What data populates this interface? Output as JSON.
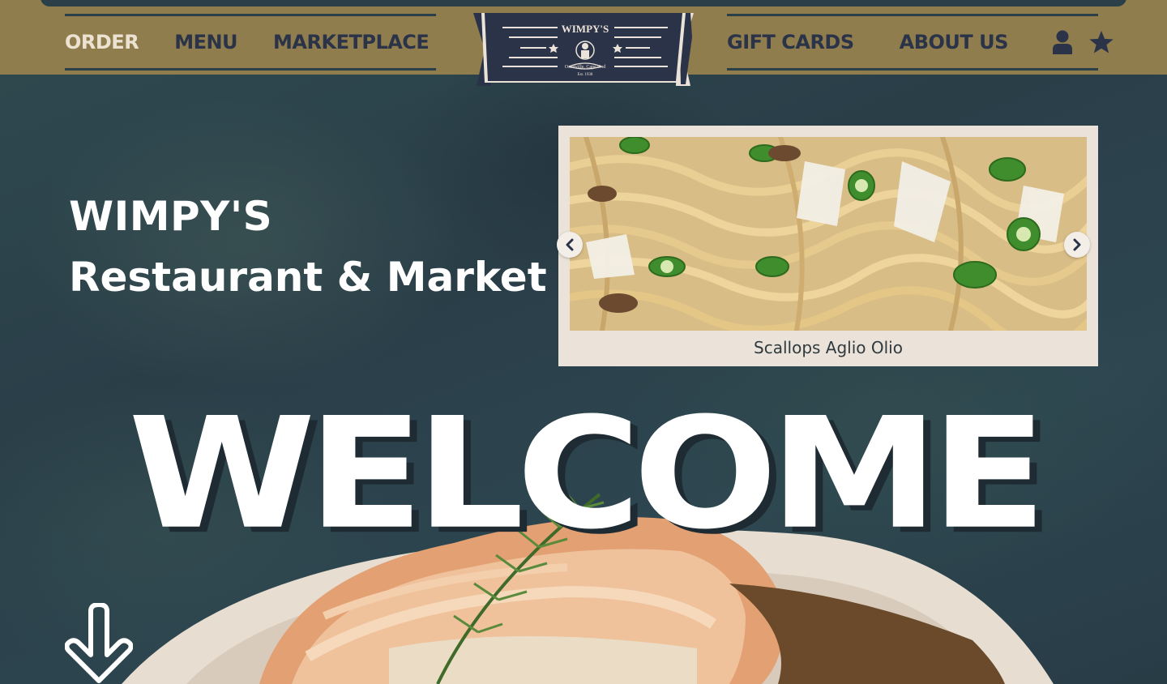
{
  "header": {
    "nav_left": [
      {
        "label": "ORDER",
        "active": true
      },
      {
        "label": "MENU",
        "active": false
      },
      {
        "label": "MARKETPLACE",
        "active": false
      }
    ],
    "nav_right": [
      {
        "label": "GIFT CARDS"
      },
      {
        "label": "ABOUT US"
      }
    ],
    "icons": [
      "user-icon",
      "star-icon"
    ],
    "logo": {
      "name": "WIMPY'S",
      "tagline": "Osterville, Cape Cod",
      "est": "Est. 1938"
    }
  },
  "hero": {
    "title": "WIMPY'S",
    "subtitle": "Restaurant & Market"
  },
  "carousel": {
    "caption": "Scallops Aglio Olio",
    "prev_icon": "chevron-left-icon",
    "next_icon": "chevron-right-icon"
  },
  "welcome": {
    "text": "WELCOME"
  },
  "colors": {
    "header_bg": "#8f7d4e",
    "navy": "#2b3348",
    "page_bg": "#2b3f48",
    "cream": "#ebe3d9"
  }
}
